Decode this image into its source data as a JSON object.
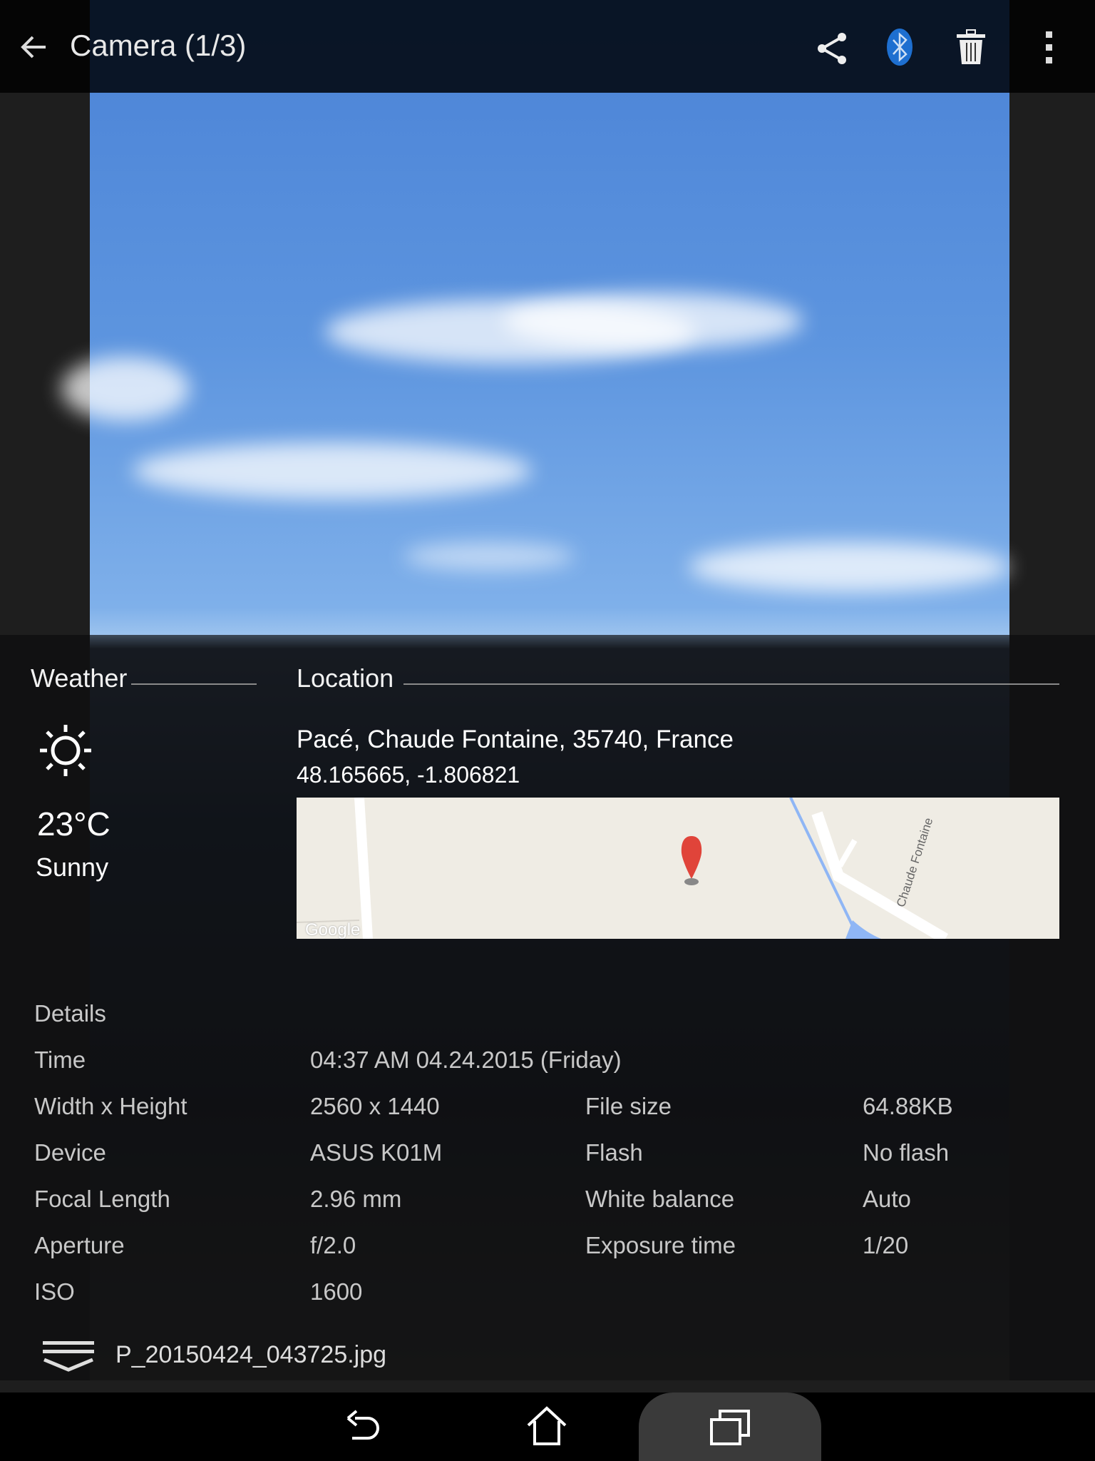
{
  "topbar": {
    "title": "Camera (1/3)",
    "icons": [
      "back-arrow-icon",
      "share-icon",
      "bluetooth-icon",
      "trash-icon",
      "more-vert-icon"
    ]
  },
  "weather": {
    "heading": "Weather",
    "icon": "sun-icon",
    "temperature": "23°C",
    "condition": "Sunny"
  },
  "location": {
    "heading": "Location",
    "address": "Pacé, Chaude Fontaine, 35740, France",
    "coordinates": "48.165665, -1.806821",
    "map_street_label": "Chaude Fontaine",
    "map_logo": "Google"
  },
  "details": {
    "heading": "Details",
    "rows": [
      {
        "label": "Time",
        "value": "04:37 AM 04.24.2015 (Friday)"
      },
      {
        "label": "Width x Height",
        "value": "2560 x 1440",
        "label2": "File size",
        "value2": "64.88KB"
      },
      {
        "label": "Device",
        "value": "ASUS K01M",
        "label2": "Flash",
        "value2": "No flash"
      },
      {
        "label": "Focal Length",
        "value": "2.96 mm",
        "label2": "White balance",
        "value2": "Auto"
      },
      {
        "label": "Aperture",
        "value": "f/2.0",
        "label2": "Exposure time",
        "value2": "1/20"
      },
      {
        "label": "ISO",
        "value": "1600"
      }
    ]
  },
  "file": {
    "name": "P_20150424_043725.jpg"
  },
  "navbar": {
    "icons": [
      "back-icon",
      "home-icon",
      "recents-icon"
    ]
  },
  "colors": {
    "bluetooth": "#1e6fd0",
    "pin": "#e0443a",
    "map_bg": "#efece4",
    "water": "#8fb6f5"
  }
}
